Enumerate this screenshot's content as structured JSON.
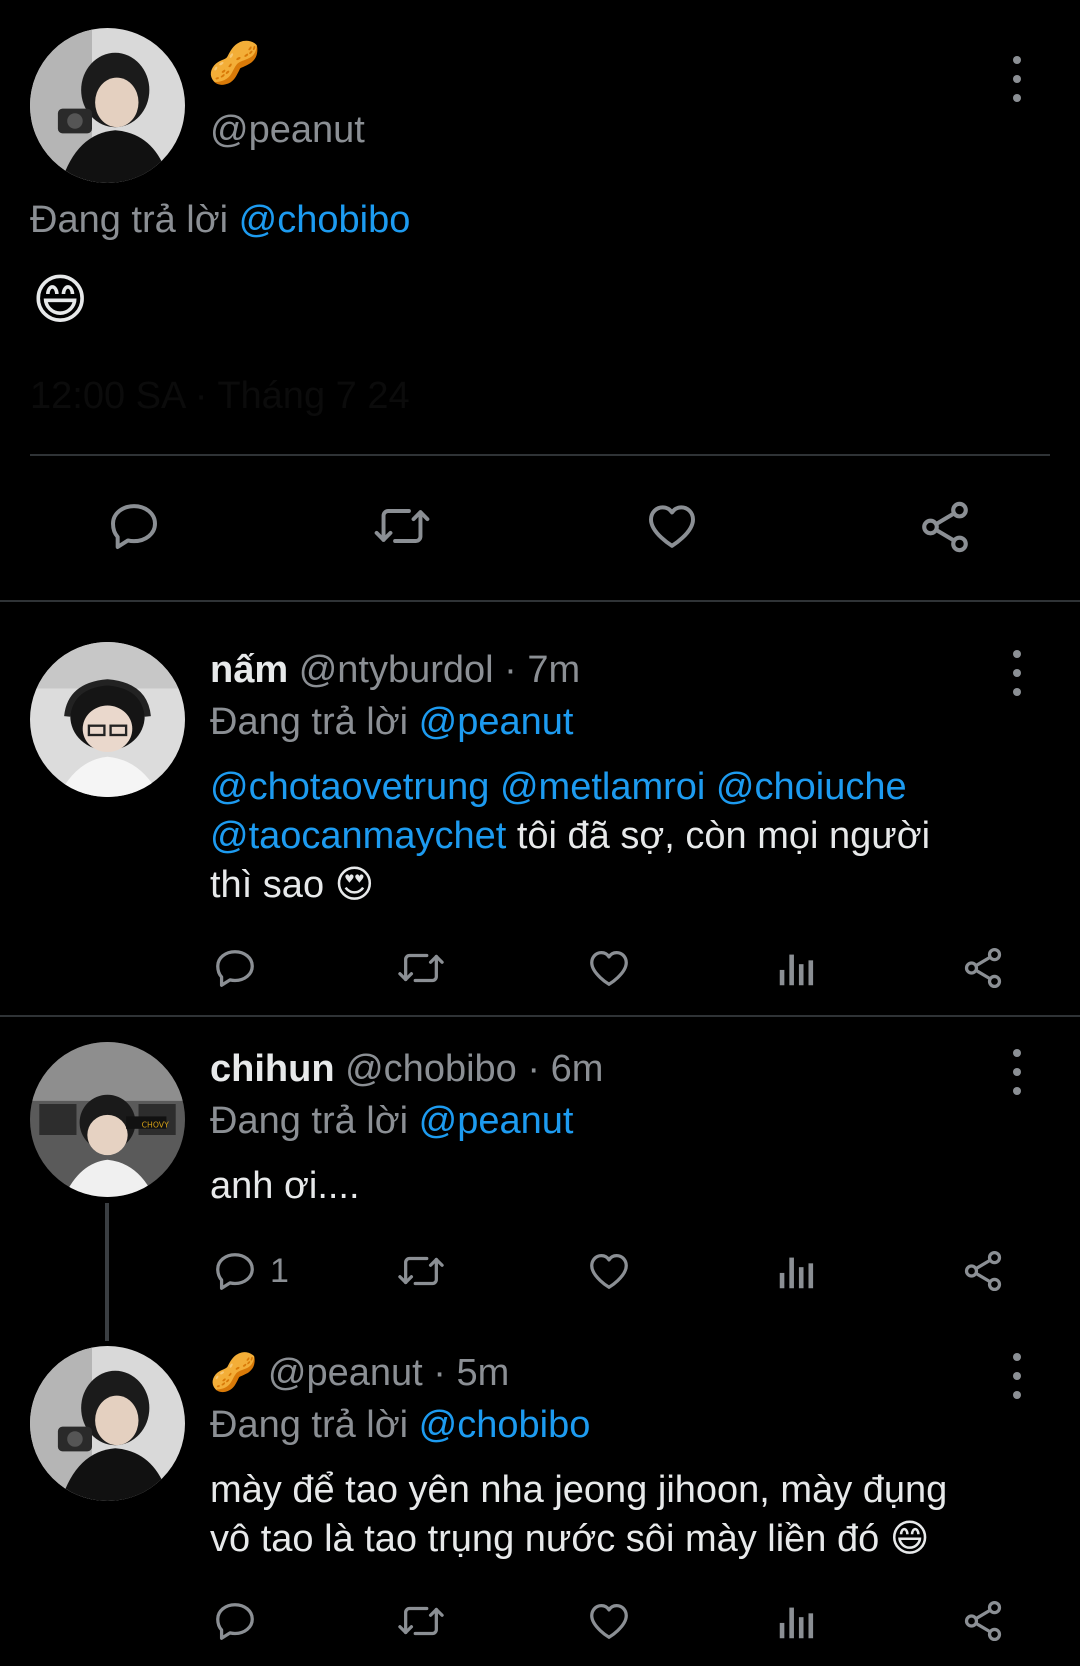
{
  "main_tweet": {
    "display_name_emoji": "🥜",
    "handle": "@peanut",
    "replying_prefix": "Đang trả lời",
    "replying_to": "@chobibo",
    "body_emoji": "😄",
    "timestamp_faint": "12:00 SA · Tháng 7 24"
  },
  "replies": [
    {
      "name": "nấm",
      "handle": "@ntyburdol",
      "time": "· 7m",
      "replying_prefix": "Đang trả lời",
      "replying_to": "@peanut",
      "mentions_line1": "@chotaovetrung @metlamroi @choiuche",
      "mention_line2": "@taocanmaychet",
      "text_line2": "tôi đã sợ, còn mọi người",
      "text_line3": "thì sao",
      "emoji": "😍",
      "reply_count": ""
    },
    {
      "name": "chihun",
      "handle": "@chobibo",
      "time": "· 6m",
      "replying_prefix": "Đang trả lời",
      "replying_to": "@peanut",
      "text": "anh ơi....",
      "reply_count": "1"
    },
    {
      "name_emoji": "🥜",
      "handle": "@peanut",
      "time": "· 5m",
      "replying_prefix": "Đang trả lời",
      "replying_to": "@chobibo",
      "text_line1": "mày để tao yên nha jeong jihoon, mày đụng",
      "text_line2": "vô tao là tao trụng nước sôi mày liền đó",
      "emoji": "😄"
    }
  ],
  "colors": {
    "background": "#000000",
    "text": "#e7e9ea",
    "secondary": "#8b8f94",
    "link": "#1d9bf0",
    "divider": "#2f3336"
  },
  "icons": [
    "reply-icon",
    "retweet-icon",
    "like-icon",
    "views-icon",
    "share-icon",
    "more-icon"
  ]
}
